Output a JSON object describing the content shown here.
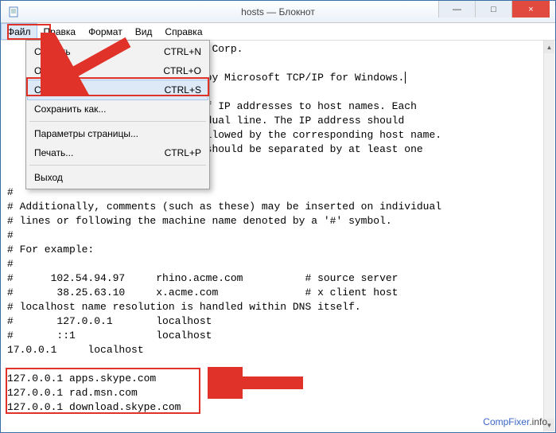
{
  "window": {
    "title": "hosts — Блокнот",
    "icon": "notepad-icon"
  },
  "win_buttons": {
    "minimize": "—",
    "maximize": "□",
    "close": "×"
  },
  "menubar": [
    {
      "label": "Файл",
      "active": true
    },
    {
      "label": "Правка",
      "active": false
    },
    {
      "label": "Формат",
      "active": false
    },
    {
      "label": "Вид",
      "active": false
    },
    {
      "label": "Справка",
      "active": false
    }
  ],
  "dropdown": {
    "items": [
      {
        "label": "Создать",
        "shortcut": "CTRL+N",
        "hover": false
      },
      {
        "label": "Открыть...",
        "shortcut": "CTRL+O",
        "hover": false
      },
      {
        "label": "Сохранить",
        "shortcut": "CTRL+S",
        "hover": true
      },
      {
        "label": "Сохранить как...",
        "shortcut": "",
        "hover": false
      }
    ],
    "items2": [
      {
        "label": "Параметры страницы...",
        "shortcut": "",
        "hover": false
      },
      {
        "label": "Печать...",
        "shortcut": "CTRL+P",
        "hover": false
      }
    ],
    "items3": [
      {
        "label": "Выход",
        "shortcut": "",
        "hover": false
      }
    ]
  },
  "text_lines": [
    "                             oft Corp.",
    "",
    "                             ed by Microsoft TCP/IP for Windows.",
    "",
    "                             s of IP addresses to host names. Each",
    "                             ividual line. The IP address should",
    "                              followed by the corresponding host name.",
    "                             me should be separated by at least one",
    "",
    "",
    "#",
    "# Additionally, comments (such as these) may be inserted on individual",
    "# lines or following the machine name denoted by a '#' symbol.",
    "#",
    "# For example:",
    "#",
    "#      102.54.94.97     rhino.acme.com          # source server",
    "#       38.25.63.10     x.acme.com              # x client host",
    "# localhost name resolution is handled within DNS itself.",
    "#       127.0.0.1       localhost",
    "#       ::1             localhost",
    "17.0.0.1     localhost",
    "",
    "127.0.0.1 apps.skype.com",
    "127.0.0.1 rad.msn.com",
    "127.0.0.1 download.skype.com"
  ],
  "watermark": {
    "a": "CompFixer",
    "b": ".info"
  }
}
